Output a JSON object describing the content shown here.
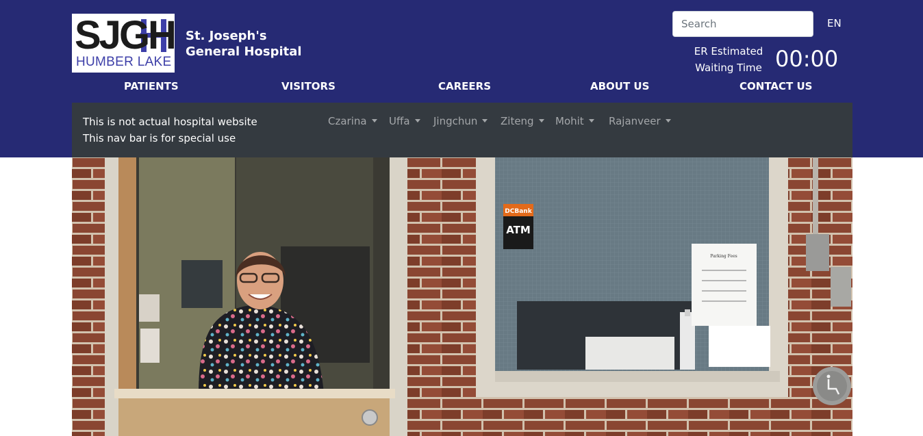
{
  "logo": {
    "text": "SJGH",
    "subtext": "HUMBER LAKE"
  },
  "header": {
    "hospital_name_line1": "St. Joseph's",
    "hospital_name_line2": "General Hospital",
    "search_placeholder": "Search",
    "language": "EN",
    "er_label_line1": "ER Estimated",
    "er_label_line2": "Waiting Time",
    "er_time": "00:00"
  },
  "nav": {
    "items": [
      {
        "label": "PATIENTS"
      },
      {
        "label": "VISITORS"
      },
      {
        "label": "CAREERS"
      },
      {
        "label": "ABOUT US"
      },
      {
        "label": "CONTACT US"
      }
    ]
  },
  "subnav": {
    "note_line1": "This is not actual hospital website",
    "note_line2": "This nav bar is for special use",
    "dropdowns": [
      {
        "label": "Czarina"
      },
      {
        "label": "Uffa"
      },
      {
        "label": "Jingchun"
      },
      {
        "label": "Ziteng"
      },
      {
        "label": "Mohit"
      },
      {
        "label": "Rajanveer"
      }
    ]
  },
  "hero": {
    "atm_brand": "DCBank",
    "atm_label": "ATM",
    "sign_heading": "Parking Fees"
  },
  "colors": {
    "header_bg": "#262a74",
    "subnav_bg": "#343a40",
    "logo_accent": "#3d3fa8",
    "brick": "#8a4632"
  }
}
